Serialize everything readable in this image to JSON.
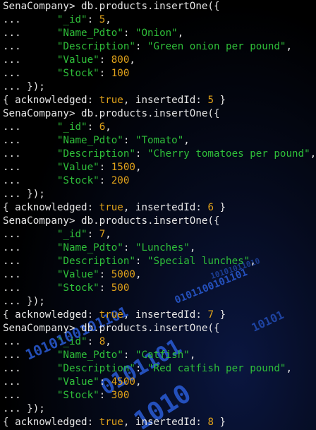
{
  "terminal": {
    "background_accent": "#0a1640",
    "colors": {
      "text": "#e6e6e6",
      "string": "#2fbf3a",
      "number": "#e0a21a"
    },
    "prompt": "SenaCompany> ",
    "continuation": "...      ",
    "command": "db.products.insertOne({",
    "close": "... });",
    "ack_open": "{ acknowledged: ",
    "ack_mid": ", insertedId: ",
    "ack_close": " }",
    "ack_value": "true",
    "field_sep": ": ",
    "comma": ",",
    "documents": [
      {
        "fields": [
          {
            "key": "\"_id\"",
            "value": "5",
            "type": "num"
          },
          {
            "key": "\"Name_Pdto\"",
            "value": "\"Onion\"",
            "type": "str"
          },
          {
            "key": "\"Description\"",
            "value": "\"Green onion per pound\"",
            "type": "str"
          },
          {
            "key": "\"Value\"",
            "value": "800",
            "type": "num"
          },
          {
            "key": "\"Stock\"",
            "value": "100",
            "type": "num"
          }
        ],
        "inserted_id": "5"
      },
      {
        "fields": [
          {
            "key": "\"_id\"",
            "value": "6",
            "type": "num"
          },
          {
            "key": "\"Name_Pdto\"",
            "value": "\"Tomato\"",
            "type": "str"
          },
          {
            "key": "\"Description\"",
            "value": "\"Cherry tomatoes per pound\"",
            "type": "str"
          },
          {
            "key": "\"Value\"",
            "value": "1500",
            "type": "num"
          },
          {
            "key": "\"Stock\"",
            "value": "200",
            "type": "num"
          }
        ],
        "inserted_id": "6"
      },
      {
        "fields": [
          {
            "key": "\"_id\"",
            "value": "7",
            "type": "num"
          },
          {
            "key": "\"Name_Pdto\"",
            "value": "\"Lunches\"",
            "type": "str"
          },
          {
            "key": "\"Description\"",
            "value": "\"Special lunches\"",
            "type": "str"
          },
          {
            "key": "\"Value\"",
            "value": "5000",
            "type": "num"
          },
          {
            "key": "\"Stock\"",
            "value": "500",
            "type": "num"
          }
        ],
        "inserted_id": "7"
      },
      {
        "fields": [
          {
            "key": "\"_id\"",
            "value": "8",
            "type": "num"
          },
          {
            "key": "\"Name_Pdto\"",
            "value": "\"Catfish\"",
            "type": "str"
          },
          {
            "key": "\"Description\"",
            "value": "\"Red catfish per pound\"",
            "type": "str"
          },
          {
            "key": "\"Value\"",
            "value": "4500",
            "type": "num"
          },
          {
            "key": "\"Stock\"",
            "value": "300",
            "type": "num"
          }
        ],
        "inserted_id": "8"
      }
    ]
  }
}
